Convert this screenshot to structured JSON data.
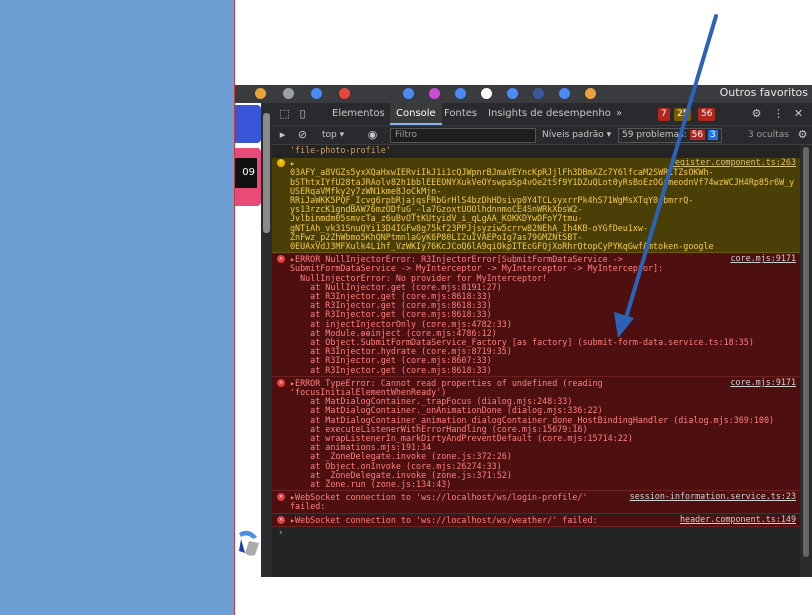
{
  "colors": {
    "left_panel": "#6e9fd4",
    "devtools_bg": "#242424",
    "warning_bg": "#4b3f08",
    "error_bg": "#4d0f0f",
    "arrow": "#2a63b8"
  },
  "browser": {
    "bookmarks_other": "Outros favoritos",
    "page_tag": "09"
  },
  "devtools": {
    "tabs": [
      "Elementos",
      "Console",
      "Fontes",
      "Insights de desempenho"
    ],
    "active_tab": "Console",
    "more_tabs": "»",
    "error_count": "7",
    "warning_count": "25",
    "issue_count_badge": "56",
    "toolbar": {
      "context": "top",
      "filter_placeholder": "Filtro",
      "levels": "Níveis padrão",
      "problems": "59 problemas:",
      "problems_errors": "56",
      "problems_info": "3",
      "hidden": "3 ocultas"
    },
    "messages": [
      {
        "kind": "plain",
        "lines": [
          "'file-photo-profile'"
        ],
        "source": ""
      },
      {
        "kind": "warn",
        "source": "register.component.ts:263",
        "lines": [
          "▸",
          "03AFY_a8VGZs5yxXQaHxwIERviIkJ1i1cQJWpnrBJmaVEYncKpRJjlFh3DBmXZc7Y6lfcaM2SWR1TZsOKWh-",
          "bSThtxIYfU28taJRAolv82h1bblEEEONYXukVeOYswpaSp4vOe2tSf9Y1DZuQLot0yRsBoEzOGimeodnVf74wzWCJH4Rp85r6W_y",
          "USERqaVMfky2y7zWN1kme8JoCkMjn-",
          "RRiJaWKK5PQF_Icvg6rpbRjajqsFRbGrHlS4bzDhHDsivp0Y4TCLsyxrrPk4hS71WgMsXTqY0cbmrrQ-",
          "ys13rzcK1gndBAW76mzODfuG_-la7GzoxtUOOlhdnnmoCE4SnWRkXbsW2-",
          "Jvlbinmdm05smvcTa_z6uBvOTtKUtyidV_i_qLgAA_KOKKDYwDFoY7tmu-",
          "gNTiAh_vk31SnuQYi13D4IGFw8g75kf23PPJjsyziw5crrw82NEhA_Ih4KB-oYGfDeu1xw-",
          "ZnFwz_p2ZhWbmo5KhQNPtmnlaGyK6P80LI2uIVAEPoIg7as79GMZNtSBT-",
          "0EUAxVdJ3MFXulk4L1hf_VzWKIy76KcJCoQ6lA9qiOkpITEcGFQjXoRhrQtopCyPYKqGwfAmtoken-google"
        ]
      },
      {
        "kind": "err",
        "source": "core.mjs:9171",
        "lines": [
          "▸ERROR NullInjectorError: R3InjectorError[SubmitFormDataService ->",
          "SubmitFormDataService -> MyInterceptor -> MyInterceptor -> MyInterceptor]:",
          "  NullInjectorError: No provider for MyInterceptor!",
          "    at NullInjector.get (core.mjs:8191:27)",
          "    at R3Injector.get (core.mjs:8618:33)",
          "    at R3Injector.get (core.mjs:8618:33)",
          "    at R3Injector.get (core.mjs:8618:33)",
          "    at injectInjectorOnly (core.mjs:4782:33)",
          "    at Module.ɵɵinject (core.mjs:4786:12)",
          "    at Object.SubmitFormDataService_Factory [as factory] (submit-form-data.service.ts:18:35)",
          "    at R3Injector.hydrate (core.mjs:8719:35)",
          "    at R3Injector.get (core.mjs:8607:33)",
          "    at R3Injector.get (core.mjs:8618:33)"
        ]
      },
      {
        "kind": "err",
        "source": "core.mjs:9171",
        "lines": [
          "▸ERROR TypeError: Cannot read properties of undefined (reading",
          "'focusInitialElementWhenReady')",
          "    at MatDialogContainer._trapFocus (dialog.mjs:248:33)",
          "    at MatDialogContainer._onAnimationDone (dialog.mjs:336:22)",
          "    at MatDialogContainer_animation_dialogContainer_done_HostBindingHandler (dialog.mjs:369:100)",
          "    at executeListenerWithErrorHandling (core.mjs:15679:16)",
          "    at wrapListenerIn_markDirtyAndPreventDefault (core.mjs:15714:22)",
          "    at animations.mjs:191:34",
          "    at _ZoneDelegate.invoke (zone.js:372:26)",
          "    at Object.onInvoke (core.mjs:26274:33)",
          "    at _ZoneDelegate.invoke (zone.js:371:52)",
          "    at Zone.run (zone.js:134:43)"
        ]
      },
      {
        "kind": "err",
        "source": "session-information.service.ts:23",
        "lines": [
          "▸WebSocket connection to 'ws://localhost/ws/login-profile/'",
          "failed:"
        ]
      },
      {
        "kind": "err",
        "source": "header.component.ts:149",
        "lines": [
          "▸WebSocket connection to 'ws://localhost/ws/weather/' failed:"
        ]
      }
    ],
    "prompt": "›"
  }
}
